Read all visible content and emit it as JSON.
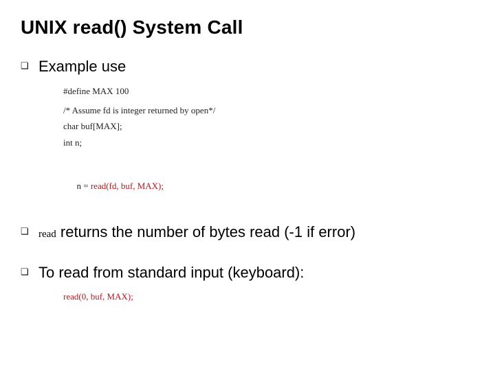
{
  "title": "UNIX read() System Call",
  "bullets": {
    "b1": "Example use",
    "b2_code": "read",
    "b2_rest": " returns the number of bytes read (-1 if error)",
    "b3": "To read from standard input (keyboard):"
  },
  "code": {
    "l1": "#define MAX 100",
    "l2": "/* Assume fd is integer returned by open*/",
    "l3": "char buf[MAX];",
    "l4": "int n;",
    "l5_lhs": "n = ",
    "l5_call": "read(fd, buf, MAX);"
  },
  "stdin_call": "read(0, buf, MAX);",
  "glyph": "❏"
}
